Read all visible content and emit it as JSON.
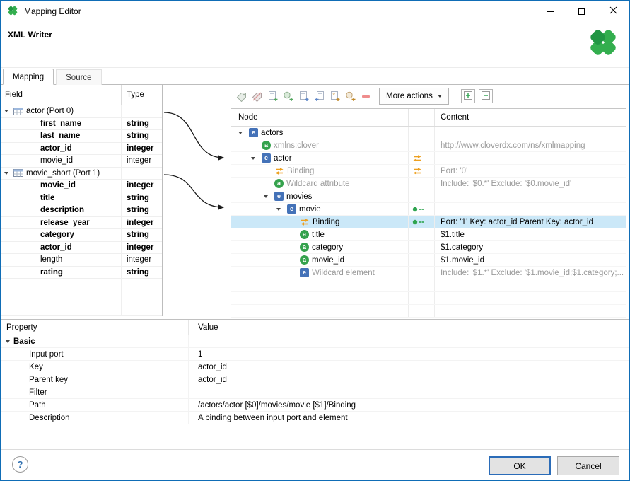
{
  "window": {
    "title": "Mapping Editor",
    "subtitle": "XML Writer"
  },
  "tabs": [
    {
      "label": "Mapping"
    },
    {
      "label": "Source"
    }
  ],
  "icons": {
    "element_glyph": "e",
    "attribute_glyph": "a",
    "help_glyph": "?"
  },
  "toolbar": {
    "more_actions": "More actions"
  },
  "fields_table": {
    "headers": {
      "field": "Field",
      "type": "Type"
    },
    "groups": [
      {
        "label": "actor (Port 0)",
        "fields": [
          {
            "name": "first_name",
            "type": "string"
          },
          {
            "name": "last_name",
            "type": "string"
          },
          {
            "name": "actor_id",
            "type": "integer"
          },
          {
            "name": "movie_id",
            "type": "integer"
          }
        ]
      },
      {
        "label": "movie_short (Port 1)",
        "fields": [
          {
            "name": "movie_id",
            "type": "integer"
          },
          {
            "name": "title",
            "type": "string"
          },
          {
            "name": "description",
            "type": "string"
          },
          {
            "name": "release_year",
            "type": "integer"
          },
          {
            "name": "category",
            "type": "string"
          },
          {
            "name": "actor_id",
            "type": "integer"
          },
          {
            "name": "length",
            "type": "integer"
          },
          {
            "name": "rating",
            "type": "string"
          }
        ]
      }
    ]
  },
  "tree": {
    "headers": {
      "node": "Node",
      "content": "Content"
    },
    "rows": [
      {
        "label": "actors",
        "content": ""
      },
      {
        "label": "xmlns:clover",
        "content": "http://www.cloverdx.com/ns/xmlmapping"
      },
      {
        "label": "actor",
        "content": ""
      },
      {
        "label": "Binding",
        "content": "Port: '0'"
      },
      {
        "label": "Wildcard attribute",
        "content": "Include: '$0.*' Exclude: '$0.movie_id'"
      },
      {
        "label": "movies",
        "content": ""
      },
      {
        "label": "movie",
        "content": ""
      },
      {
        "label": "Binding",
        "content": "Port: '1' Key: actor_id Parent Key: actor_id"
      },
      {
        "label": "title",
        "content": "$1.title"
      },
      {
        "label": "category",
        "content": "$1.category"
      },
      {
        "label": "movie_id",
        "content": "$1.movie_id"
      },
      {
        "label": "Wildcard element",
        "content": "Include: '$1.*' Exclude: '$1.movie_id;$1.category;..."
      }
    ]
  },
  "properties": {
    "headers": {
      "property": "Property",
      "value": "Value"
    },
    "section": "Basic",
    "rows": [
      {
        "property": "Input port",
        "value": "1"
      },
      {
        "property": "Key",
        "value": "actor_id"
      },
      {
        "property": "Parent key",
        "value": "actor_id"
      },
      {
        "property": "Filter",
        "value": ""
      },
      {
        "property": "Path",
        "value": "/actors/actor [$0]/movies/movie [$1]/Binding"
      },
      {
        "property": "Description",
        "value": "A binding between input port and element"
      }
    ]
  },
  "footer": {
    "ok": "OK",
    "cancel": "Cancel"
  }
}
